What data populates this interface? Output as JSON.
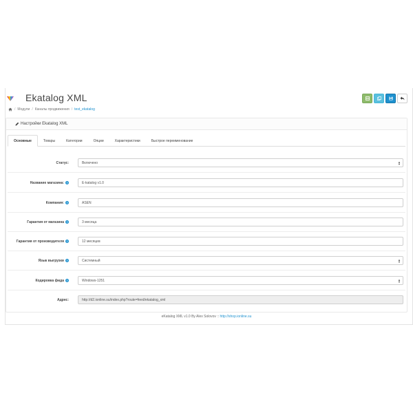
{
  "header": {
    "title": "Ekatalog XML",
    "breadcrumb": [
      "Модули",
      "Каналы продвижения",
      "test_ekatalog"
    ]
  },
  "toolbar": {
    "buttons": [
      {
        "name": "generate",
        "icon": "table-icon",
        "color": "#8fbb6c"
      },
      {
        "name": "copy",
        "icon": "copy-icon",
        "color": "#5bc0de"
      },
      {
        "name": "save",
        "icon": "save-icon",
        "color": "#1e91cf"
      },
      {
        "name": "back",
        "icon": "reply-icon",
        "color": "#ffffff"
      }
    ]
  },
  "panel": {
    "heading": "Настройки Ekatalog XML"
  },
  "tabs": [
    {
      "label": "Основные",
      "active": true
    },
    {
      "label": "Товары",
      "active": false
    },
    {
      "label": "Категории",
      "active": false
    },
    {
      "label": "Опции",
      "active": false
    },
    {
      "label": "Характеристики",
      "active": false
    },
    {
      "label": "Быстрое переименование",
      "active": false
    }
  ],
  "form": {
    "status": {
      "label": "Статус:",
      "value": "Включено"
    },
    "shop_name": {
      "label": "Название магазина:",
      "value": "E-katalog v1.0"
    },
    "company": {
      "label": "Компания:",
      "value": "ASEN"
    },
    "shop_warranty": {
      "label": "Гарантия от магазина",
      "value": "3 месяца"
    },
    "manufacturer_warranty": {
      "label": "Гарантия от производителя",
      "value": "12 месяцев"
    },
    "export_language": {
      "label": "Язык выгрузки",
      "value": "Системный"
    },
    "feed_encoding": {
      "label": "Кодировка фида",
      "value": "Windows-1251"
    },
    "address": {
      "label": "Адрес:",
      "value": "http://d2.ionline.su/index.php?route=feed/ekatalog_xml"
    }
  },
  "footer": {
    "text": "eKatalog XML v1.0 By Alex Solovov :: ",
    "link": "http://shop.ionline.su"
  },
  "colors": {
    "accent": "#1e91cf",
    "green": "#8fbb6c",
    "light_blue": "#5bc0de"
  }
}
